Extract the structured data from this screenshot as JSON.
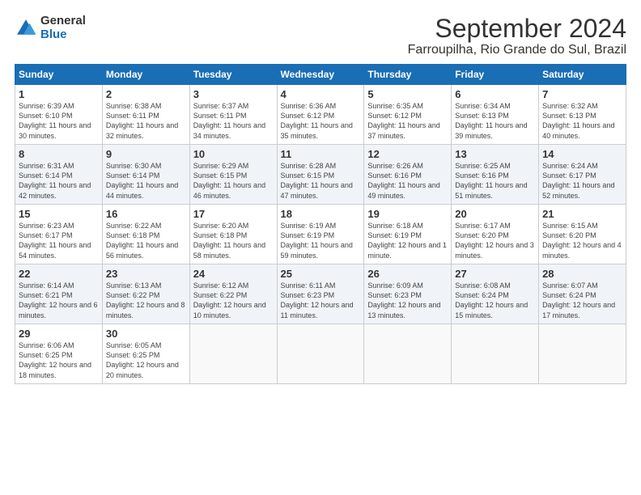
{
  "logo": {
    "general": "General",
    "blue": "Blue"
  },
  "calendar": {
    "title": "September 2024",
    "subtitle": "Farroupilha, Rio Grande do Sul, Brazil",
    "headers": [
      "Sunday",
      "Monday",
      "Tuesday",
      "Wednesday",
      "Thursday",
      "Friday",
      "Saturday"
    ],
    "weeks": [
      [
        {
          "day": "1",
          "sunrise": "6:39 AM",
          "sunset": "6:10 PM",
          "daylight": "11 hours and 30 minutes."
        },
        {
          "day": "2",
          "sunrise": "6:38 AM",
          "sunset": "6:11 PM",
          "daylight": "11 hours and 32 minutes."
        },
        {
          "day": "3",
          "sunrise": "6:37 AM",
          "sunset": "6:11 PM",
          "daylight": "11 hours and 34 minutes."
        },
        {
          "day": "4",
          "sunrise": "6:36 AM",
          "sunset": "6:12 PM",
          "daylight": "11 hours and 35 minutes."
        },
        {
          "day": "5",
          "sunrise": "6:35 AM",
          "sunset": "6:12 PM",
          "daylight": "11 hours and 37 minutes."
        },
        {
          "day": "6",
          "sunrise": "6:34 AM",
          "sunset": "6:13 PM",
          "daylight": "11 hours and 39 minutes."
        },
        {
          "day": "7",
          "sunrise": "6:32 AM",
          "sunset": "6:13 PM",
          "daylight": "11 hours and 40 minutes."
        }
      ],
      [
        {
          "day": "8",
          "sunrise": "6:31 AM",
          "sunset": "6:14 PM",
          "daylight": "11 hours and 42 minutes."
        },
        {
          "day": "9",
          "sunrise": "6:30 AM",
          "sunset": "6:14 PM",
          "daylight": "11 hours and 44 minutes."
        },
        {
          "day": "10",
          "sunrise": "6:29 AM",
          "sunset": "6:15 PM",
          "daylight": "11 hours and 46 minutes."
        },
        {
          "day": "11",
          "sunrise": "6:28 AM",
          "sunset": "6:15 PM",
          "daylight": "11 hours and 47 minutes."
        },
        {
          "day": "12",
          "sunrise": "6:26 AM",
          "sunset": "6:16 PM",
          "daylight": "11 hours and 49 minutes."
        },
        {
          "day": "13",
          "sunrise": "6:25 AM",
          "sunset": "6:16 PM",
          "daylight": "11 hours and 51 minutes."
        },
        {
          "day": "14",
          "sunrise": "6:24 AM",
          "sunset": "6:17 PM",
          "daylight": "11 hours and 52 minutes."
        }
      ],
      [
        {
          "day": "15",
          "sunrise": "6:23 AM",
          "sunset": "6:17 PM",
          "daylight": "11 hours and 54 minutes."
        },
        {
          "day": "16",
          "sunrise": "6:22 AM",
          "sunset": "6:18 PM",
          "daylight": "11 hours and 56 minutes."
        },
        {
          "day": "17",
          "sunrise": "6:20 AM",
          "sunset": "6:18 PM",
          "daylight": "11 hours and 58 minutes."
        },
        {
          "day": "18",
          "sunrise": "6:19 AM",
          "sunset": "6:19 PM",
          "daylight": "11 hours and 59 minutes."
        },
        {
          "day": "19",
          "sunrise": "6:18 AM",
          "sunset": "6:19 PM",
          "daylight": "12 hours and 1 minute."
        },
        {
          "day": "20",
          "sunrise": "6:17 AM",
          "sunset": "6:20 PM",
          "daylight": "12 hours and 3 minutes."
        },
        {
          "day": "21",
          "sunrise": "6:15 AM",
          "sunset": "6:20 PM",
          "daylight": "12 hours and 4 minutes."
        }
      ],
      [
        {
          "day": "22",
          "sunrise": "6:14 AM",
          "sunset": "6:21 PM",
          "daylight": "12 hours and 6 minutes."
        },
        {
          "day": "23",
          "sunrise": "6:13 AM",
          "sunset": "6:22 PM",
          "daylight": "12 hours and 8 minutes."
        },
        {
          "day": "24",
          "sunrise": "6:12 AM",
          "sunset": "6:22 PM",
          "daylight": "12 hours and 10 minutes."
        },
        {
          "day": "25",
          "sunrise": "6:11 AM",
          "sunset": "6:23 PM",
          "daylight": "12 hours and 11 minutes."
        },
        {
          "day": "26",
          "sunrise": "6:09 AM",
          "sunset": "6:23 PM",
          "daylight": "12 hours and 13 minutes."
        },
        {
          "day": "27",
          "sunrise": "6:08 AM",
          "sunset": "6:24 PM",
          "daylight": "12 hours and 15 minutes."
        },
        {
          "day": "28",
          "sunrise": "6:07 AM",
          "sunset": "6:24 PM",
          "daylight": "12 hours and 17 minutes."
        }
      ],
      [
        {
          "day": "29",
          "sunrise": "6:06 AM",
          "sunset": "6:25 PM",
          "daylight": "12 hours and 18 minutes."
        },
        {
          "day": "30",
          "sunrise": "6:05 AM",
          "sunset": "6:25 PM",
          "daylight": "12 hours and 20 minutes."
        },
        null,
        null,
        null,
        null,
        null
      ]
    ]
  }
}
